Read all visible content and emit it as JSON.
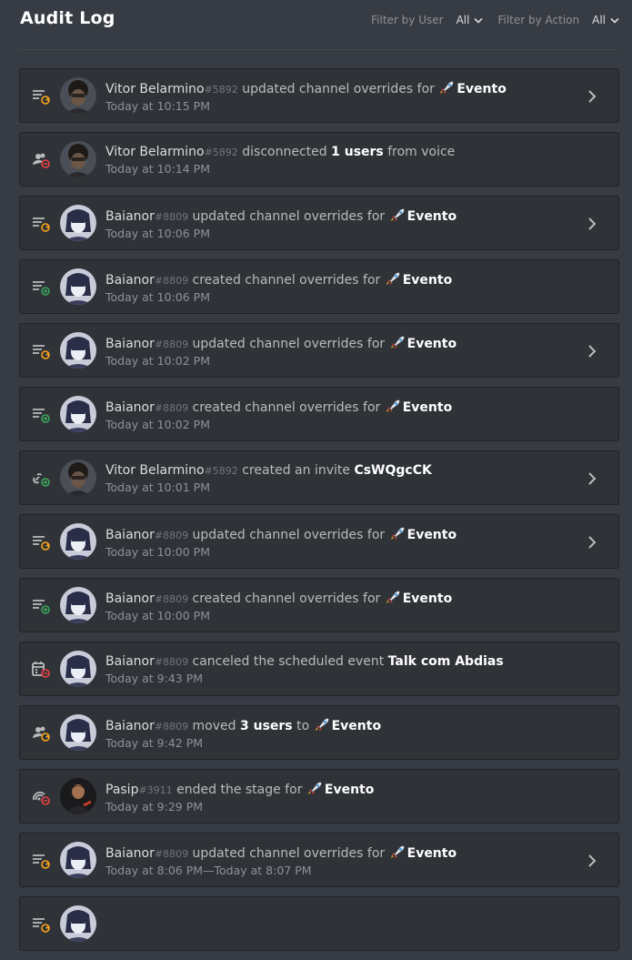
{
  "header": {
    "title": "Audit Log",
    "filter_user_label": "Filter by User",
    "filter_user_value": "All",
    "filter_action_label": "Filter by Action",
    "filter_action_value": "All"
  },
  "colors": {
    "background": "#373b43",
    "card": "#2f3237",
    "accent_red": "#ed4245",
    "accent_green": "#3ba55d"
  },
  "entries": [
    {
      "user": "Vitor Belarmino",
      "disc": "#5892",
      "action": "updated channel overrides for",
      "target": "Evento",
      "target_rocket": true,
      "time": "Today at 10:15 PM",
      "icon": "channel-update-icon",
      "avatar": "vitor",
      "chevron": true
    },
    {
      "user": "Vitor Belarmino",
      "disc": "#5892",
      "action": "disconnected",
      "target": "1 users",
      "target_rocket": false,
      "suffix": "from voice",
      "time": "Today at 10:14 PM",
      "icon": "member-disconnect-icon",
      "avatar": "vitor",
      "chevron": false
    },
    {
      "user": "Baianor",
      "disc": "#8809",
      "action": "updated channel overrides for",
      "target": "Evento",
      "target_rocket": true,
      "time": "Today at 10:06 PM",
      "icon": "channel-update-icon",
      "avatar": "baianor",
      "chevron": true
    },
    {
      "user": "Baianor",
      "disc": "#8809",
      "action": "created channel overrides for",
      "target": "Evento",
      "target_rocket": true,
      "time": "Today at 10:06 PM",
      "icon": "channel-create-icon",
      "avatar": "baianor",
      "chevron": false
    },
    {
      "user": "Baianor",
      "disc": "#8809",
      "action": "updated channel overrides for",
      "target": "Evento",
      "target_rocket": true,
      "time": "Today at 10:02 PM",
      "icon": "channel-update-icon",
      "avatar": "baianor",
      "chevron": true
    },
    {
      "user": "Baianor",
      "disc": "#8809",
      "action": "created channel overrides for",
      "target": "Evento",
      "target_rocket": true,
      "time": "Today at 10:02 PM",
      "icon": "channel-create-icon",
      "avatar": "baianor",
      "chevron": false
    },
    {
      "user": "Vitor Belarmino",
      "disc": "#5892",
      "action": "created an invite",
      "target": "CsWQgcCK",
      "target_rocket": false,
      "time": "Today at 10:01 PM",
      "icon": "invite-create-icon",
      "avatar": "vitor",
      "chevron": true
    },
    {
      "user": "Baianor",
      "disc": "#8809",
      "action": "updated channel overrides for",
      "target": "Evento",
      "target_rocket": true,
      "time": "Today at 10:00 PM",
      "icon": "channel-update-icon",
      "avatar": "baianor",
      "chevron": true
    },
    {
      "user": "Baianor",
      "disc": "#8809",
      "action": "created channel overrides for",
      "target": "Evento",
      "target_rocket": true,
      "time": "Today at 10:00 PM",
      "icon": "channel-create-icon",
      "avatar": "baianor",
      "chevron": false
    },
    {
      "user": "Baianor",
      "disc": "#8809",
      "action": "canceled the scheduled event",
      "target": "Talk com Abdias",
      "target_rocket": false,
      "time": "Today at 9:43 PM",
      "icon": "event-cancel-icon",
      "avatar": "baianor",
      "chevron": false
    },
    {
      "user": "Baianor",
      "disc": "#8809",
      "action": "moved",
      "target": "3 users",
      "target_rocket": false,
      "suffix": "to",
      "suffix_target": "Evento",
      "time": "Today at 9:42 PM",
      "icon": "member-move-icon",
      "avatar": "baianor",
      "chevron": false
    },
    {
      "user": "Pasip",
      "disc": "#3911",
      "action": "ended the stage for",
      "target": "Evento",
      "target_rocket": true,
      "time": "Today at 9:29 PM",
      "icon": "stage-end-icon",
      "avatar": "pasip",
      "chevron": false
    },
    {
      "user": "Baianor",
      "disc": "#8809",
      "action": "updated channel overrides for",
      "target": "Evento",
      "target_rocket": true,
      "time": "Today at 8:06 PM—Today at 8:07 PM",
      "icon": "channel-update-icon",
      "avatar": "baianor",
      "chevron": true
    },
    {
      "user": "",
      "disc": "",
      "action": "",
      "target": "",
      "target_rocket": false,
      "time": "",
      "icon": "channel-update-icon",
      "avatar": "baianor",
      "chevron": false
    }
  ]
}
